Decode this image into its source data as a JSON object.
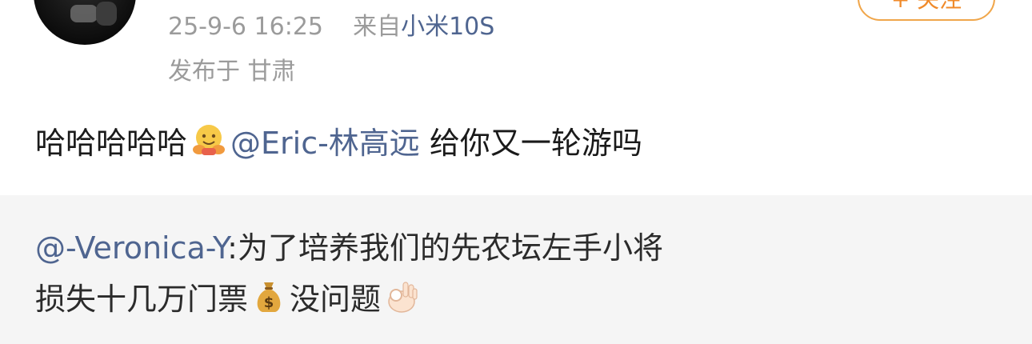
{
  "post": {
    "meta": {
      "timestamp": "25-9-6 16:25",
      "source_prefix": "来自",
      "device": "小米10S"
    },
    "location": "发布于 甘肃",
    "follow_label": "+ 关注",
    "content": {
      "text": "哈哈哈哈哈",
      "emoji_name": "hugging-face-icon",
      "mention": "@Eric-林高远",
      "trailing": " 给你又一轮游吗"
    },
    "repost": {
      "author": "@-Veronica-Y",
      "line1": ":为了培养我们的先农坛左手小将",
      "line2_a": "损失十几万门票",
      "emoji1_name": "money-bag-icon",
      "line2_b": "没问题",
      "emoji2_name": "ok-hand-icon"
    }
  },
  "colors": {
    "link": "#4f6590",
    "meta_gray": "#9b9b9b",
    "text": "#1a1a1a",
    "follow_orange": "#f08a2a",
    "repost_bg": "#f5f5f5"
  }
}
